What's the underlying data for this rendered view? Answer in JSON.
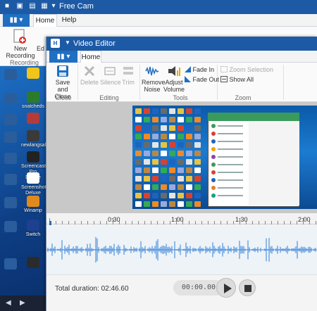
{
  "freecam": {
    "title": "Free Cam",
    "menu_label": "▮▮ ▾",
    "tabs": [
      "Home",
      "Help"
    ],
    "new_recording_label": "New Recording",
    "edit_label": "Ed",
    "group_recording": "Recording"
  },
  "desktop_icons": [
    {
      "label": "",
      "color": "#f0c419"
    },
    {
      "label": "snatcheds",
      "color": "#2c7a2c"
    },
    {
      "label": "",
      "color": "#b23b3b"
    },
    {
      "label": "newlangsah.s",
      "color": "#3a3a3a"
    },
    {
      "label": "Screencast Pro Deluxe",
      "color": "#222222"
    },
    {
      "label": "Screenshot Deluxe",
      "color": "#ffffff"
    },
    {
      "label": "Winamp",
      "color": "#e08a1e"
    },
    {
      "label": "Switch",
      "color": "#1f3f8f"
    },
    {
      "label": "",
      "color": "#2b2b2b"
    }
  ],
  "editor": {
    "title": "Video Editor",
    "logo": "H",
    "menu_label": "▮▮ ▾",
    "tab_home": "Home",
    "ribbon": {
      "save_close": "Save and Close",
      "delete": "Delete",
      "silence": "Silence",
      "trim": "Trim",
      "remove_noise": "Remove Noise",
      "adjust_volume": "Adjust Volume",
      "fade_in": "Fade In",
      "fade_out": "Fade Out",
      "zoom_selection": "Zoom Selection",
      "show_all": "Show All"
    },
    "groups": {
      "close": "Close",
      "editing": "Editing",
      "tools": "Tools",
      "zoom": "Zoom"
    },
    "timeline": {
      "ticks": [
        "0:30",
        "1:00",
        "1:30",
        "2:00"
      ],
      "total_duration_label": "Total duration: 02:46.60",
      "current_time": "00:00.00"
    }
  },
  "taskbar": {
    "icons": [
      "◀",
      "▶"
    ]
  }
}
